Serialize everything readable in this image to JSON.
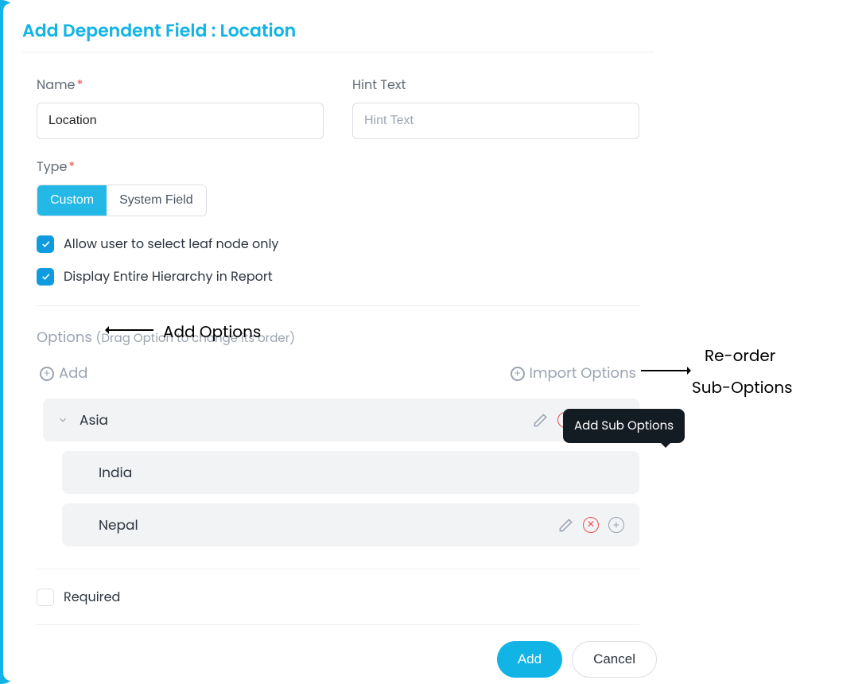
{
  "title": "Add Dependent Field : Location",
  "name": {
    "label": "Name",
    "value": "Location"
  },
  "hint": {
    "label": "Hint Text",
    "placeholder": "Hint Text",
    "value": ""
  },
  "type": {
    "label": "Type",
    "custom": "Custom",
    "system": "System Field"
  },
  "checks": {
    "leaf": "Allow user to select leaf node only",
    "hier": "Display Entire Hierarchy in Report"
  },
  "options": {
    "heading": "Options",
    "hint": "(Drag Option to change its order)",
    "add": "Add",
    "import": "Import Options"
  },
  "tree": {
    "parent": "Asia",
    "children": [
      "India",
      "Nepal"
    ]
  },
  "tooltip": "Add Sub Options",
  "required": "Required",
  "buttons": {
    "add": "Add",
    "cancel": "Cancel"
  },
  "annotations": {
    "addOptions": "Add Options",
    "reorder1": "Re-order",
    "reorder2": "Sub-Options"
  }
}
